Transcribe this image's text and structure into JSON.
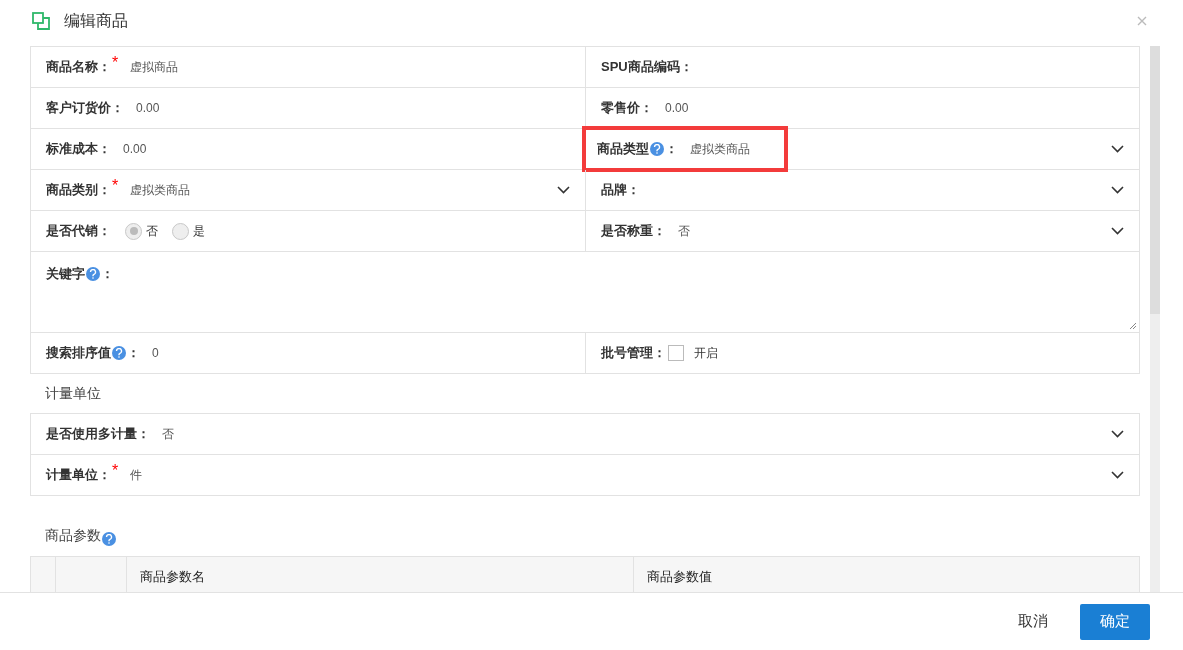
{
  "dialog": {
    "title": "编辑商品"
  },
  "form_rows": [
    {
      "cells": [
        {
          "kind": "text",
          "label": "商品名称：",
          "required_mark": "*",
          "value": "虚拟商品"
        },
        {
          "kind": "text",
          "label": "SPU商品编码："
        }
      ]
    },
    {
      "cells": [
        {
          "kind": "text",
          "label": "客户订货价：",
          "value": "0.00"
        },
        {
          "kind": "text",
          "label": "零售价：",
          "value": "0.00"
        }
      ]
    },
    {
      "cells": [
        {
          "kind": "text",
          "label": "标准成本：",
          "value": "0.00"
        },
        {
          "kind": "select",
          "label": "商品类型",
          "help": true,
          "label_suffix": "：",
          "value": "虚拟类商品",
          "highlighted": true
        }
      ]
    },
    {
      "cells": [
        {
          "kind": "select",
          "label": "商品类别：",
          "required_mark": "*",
          "value": "虚拟类商品"
        },
        {
          "kind": "select",
          "label": "品牌："
        }
      ]
    },
    {
      "cells": [
        {
          "kind": "radio",
          "label": "是否代销：",
          "options": [
            {
              "label": "否",
              "selected": true,
              "disabled": true
            },
            {
              "label": "是",
              "selected": false,
              "disabled": true
            }
          ]
        },
        {
          "kind": "select",
          "label": "是否称重：",
          "value": "否"
        }
      ]
    },
    {
      "cells": [
        {
          "kind": "textarea",
          "label": "关键字",
          "help": true,
          "label_suffix": "："
        }
      ]
    },
    {
      "cells": [
        {
          "kind": "text",
          "label": "搜索排序值",
          "help": true,
          "label_suffix": "：",
          "value": "0"
        },
        {
          "kind": "checkbox",
          "label": "批号管理：",
          "checked": false,
          "option": "开启"
        }
      ]
    }
  ],
  "unit_section": {
    "title": "计量单位",
    "rows": [
      {
        "kind": "select",
        "label": "是否使用多计量：",
        "value": "否"
      },
      {
        "kind": "select",
        "label": "计量单位：",
        "required_mark": "*",
        "value": "件"
      }
    ]
  },
  "params_section": {
    "title": "商品参数",
    "help": true,
    "table": {
      "columns": [
        "商品参数名",
        "商品参数值"
      ]
    }
  },
  "buttons": [
    {
      "label": "取消",
      "kind": "secondary"
    },
    {
      "label": "确定",
      "kind": "primary"
    }
  ]
}
